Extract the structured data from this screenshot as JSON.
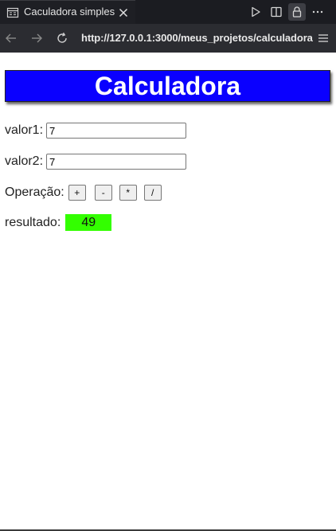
{
  "browser": {
    "tab": {
      "title": "Caculadora simples",
      "icon": "reader-icon"
    },
    "toolbar_icons": [
      "play-icon",
      "split-view-icon",
      "lock-icon",
      "more-icon"
    ],
    "nav": {
      "back_icon": "back-arrow-icon",
      "forward_icon": "forward-arrow-icon",
      "reload_icon": "reload-icon",
      "url": "http://127.0.0.1:3000/meus_projetos/calculadora",
      "menu_icon": "hamburger-menu-icon"
    }
  },
  "page": {
    "title": "Calculadora",
    "valor1": {
      "label": "valor1:",
      "value": "7"
    },
    "valor2": {
      "label": "valor2:",
      "value": "7"
    },
    "operacao": {
      "label": "Operação:",
      "buttons": [
        "+",
        "-",
        "*",
        "/"
      ]
    },
    "resultado": {
      "label": "resultado:",
      "value": "49"
    }
  },
  "colors": {
    "header_bg": "#0a00ff",
    "header_text": "#ffffff",
    "result_bg": "#33ff00",
    "chrome_dark": "#1b1c21",
    "address_bar": "#2b2c31"
  }
}
